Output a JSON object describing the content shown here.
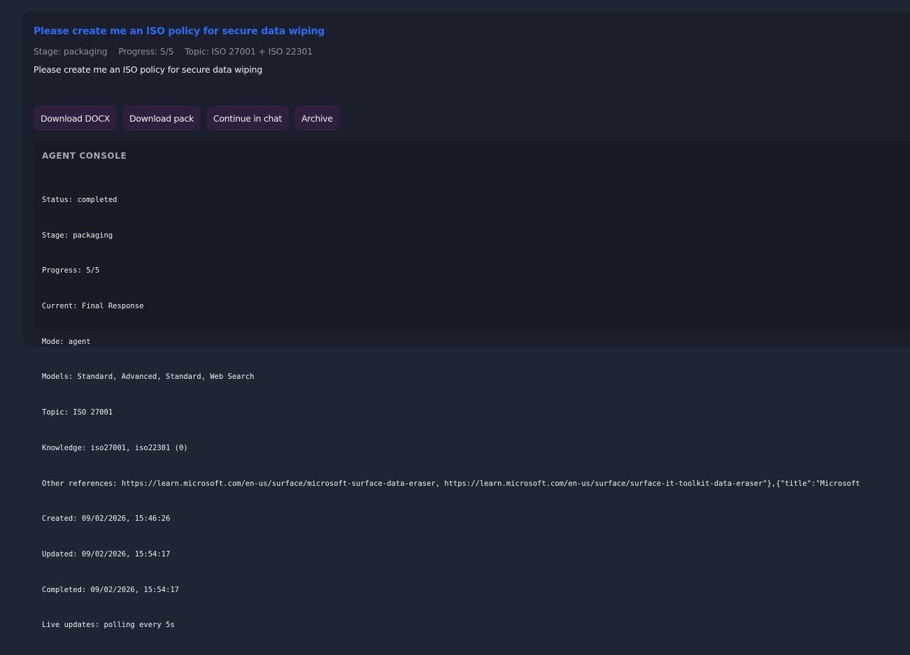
{
  "task": {
    "title": "Please create me an ISO policy for secure data wiping",
    "meta": {
      "stage": "Stage: packaging",
      "progress": "Progress: 5/5",
      "topic": "Topic: ISO 27001 + ISO 22301"
    },
    "prompt": "Please create me an ISO policy for secure data wiping"
  },
  "actions": {
    "download_docx": "Download DOCX",
    "download_pack": "Download pack",
    "continue_chat": "Continue in chat",
    "archive": "Archive"
  },
  "console": {
    "heading": "AGENT CONSOLE",
    "lines": [
      "Status: completed",
      "Stage: packaging",
      "Progress: 5/5",
      "Current: Final Response",
      "Mode: agent",
      "Models: Standard, Advanced, Standard, Web Search",
      "Topic: ISO 27001",
      "Knowledge: iso27001, iso22301 (0)",
      "Other references: https://learn.microsoft.com/en-us/surface/microsoft-surface-data-eraser, https://learn.microsoft.com/en-us/surface/surface-it-toolkit-data-eraser\"},{\"title\":\"Microsoft",
      "Created: 09/02/2026, 15:46:26",
      "Updated: 09/02/2026, 15:54:17",
      "Completed: 09/02/2026, 15:54:17",
      "Live updates: polling every 5s"
    ]
  },
  "colors": {
    "title": "#2f6bf2",
    "button_bg": "#2d1f3e",
    "card_bg": "#1b1e2b",
    "console_bg": "#181b25",
    "page_bg": "#1f2633"
  }
}
